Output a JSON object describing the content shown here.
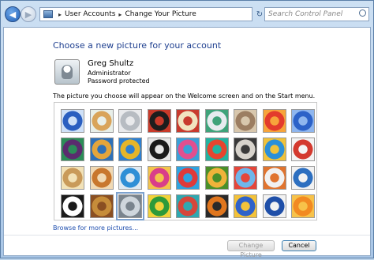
{
  "nav": {
    "breadcrumb": [
      "User Accounts",
      "Change Your Picture"
    ],
    "search_placeholder": "Search Control Panel",
    "back_glyph": "◀",
    "forward_glyph": "▶",
    "refresh_glyph": "↻",
    "crumb_separator": "▸"
  },
  "main": {
    "heading": "Choose a new picture for your account",
    "user": {
      "name": "Greg Shultz",
      "role": "Administrator",
      "status": "Password protected"
    },
    "info": "The picture you choose will appear on the Welcome screen and on the Start menu.",
    "pictures": [
      {
        "icon": "blue-glass-tile",
        "colors": [
          "#2a5fc0",
          "#cfe1f7"
        ]
      },
      {
        "icon": "starfish",
        "colors": [
          "#d9a45a",
          "#e8efe9"
        ]
      },
      {
        "icon": "robot-figure",
        "colors": [
          "#b7bcc2",
          "#e9eaec"
        ]
      },
      {
        "icon": "vinyl-record",
        "colors": [
          "#1d1d1d",
          "#c93a2a"
        ]
      },
      {
        "icon": "lucky-cat",
        "colors": [
          "#f1e3c0",
          "#c83a2e"
        ]
      },
      {
        "icon": "satellite-dish",
        "colors": [
          "#e7ecef",
          "#3fa37a"
        ]
      },
      {
        "icon": "kitten",
        "colors": [
          "#9c7e62",
          "#d8c7ad"
        ]
      },
      {
        "icon": "red-flower",
        "colors": [
          "#e33b2c",
          "#f7a43b"
        ]
      },
      {
        "icon": "blue-abstract",
        "colors": [
          "#2c62c8",
          "#8fb6ee"
        ]
      },
      {
        "icon": "purple-ball",
        "colors": [
          "#5b2b6e",
          "#2c8d58"
        ]
      },
      {
        "icon": "color-blocks",
        "colors": [
          "#e3a53b",
          "#2d70b8"
        ]
      },
      {
        "icon": "leaf",
        "colors": [
          "#e6b52a",
          "#2e7fd0"
        ]
      },
      {
        "icon": "puppy",
        "colors": [
          "#1a1a1a",
          "#e6e6e6"
        ]
      },
      {
        "icon": "crayons",
        "colors": [
          "#e24f8f",
          "#3aa0d8"
        ]
      },
      {
        "icon": "butterfly-pattern",
        "colors": [
          "#e6452f",
          "#23b3a0"
        ]
      },
      {
        "icon": "geometric-hearts",
        "colors": [
          "#d7d3cc",
          "#3a3a3a"
        ]
      },
      {
        "icon": "pool-stripes",
        "colors": [
          "#2a8fd8",
          "#f0c23a"
        ]
      },
      {
        "icon": "paper-crane",
        "colors": [
          "#d43a2f",
          "#f4f4f4"
        ]
      },
      {
        "icon": "guitar",
        "colors": [
          "#c99a5a",
          "#f2e2b8"
        ]
      },
      {
        "icon": "fox-cub",
        "colors": [
          "#c8772e",
          "#f0d9b4"
        ]
      },
      {
        "icon": "toy-robot",
        "colors": [
          "#2f8fd6",
          "#dfe9f1"
        ]
      },
      {
        "icon": "sari-fabric",
        "colors": [
          "#d93e8a",
          "#f3c34c"
        ]
      },
      {
        "icon": "rainbow-ribbons",
        "colors": [
          "#e03a3a",
          "#2fa3df"
        ]
      },
      {
        "icon": "sunset-field",
        "colors": [
          "#f0b33a",
          "#4a8f2a"
        ]
      },
      {
        "icon": "hot-air-balloons",
        "colors": [
          "#6fb6ea",
          "#e5463a"
        ]
      },
      {
        "icon": "clay-doll",
        "colors": [
          "#f1f1f1",
          "#e0742f"
        ]
      },
      {
        "icon": "sailboats",
        "colors": [
          "#2d6fc0",
          "#f2f2f2"
        ]
      },
      {
        "icon": "soccer-ball",
        "colors": [
          "#ffffff",
          "#1a1a1a"
        ]
      },
      {
        "icon": "wood-carving",
        "colors": [
          "#c68d3a",
          "#8a4f22"
        ]
      },
      {
        "icon": "robot-toy-selected",
        "colors": [
          "#cfd6dc",
          "#7a848d"
        ]
      },
      {
        "icon": "window-frame",
        "colors": [
          "#2d9a3a",
          "#f2d23a"
        ]
      },
      {
        "icon": "woven-fabric",
        "colors": [
          "#d6463a",
          "#2fa8b0"
        ]
      },
      {
        "icon": "monarch-butterfly",
        "colors": [
          "#e0761e",
          "#2a2a2a"
        ]
      },
      {
        "icon": "stained-glass",
        "colors": [
          "#2f62c9",
          "#f3c23a"
        ]
      },
      {
        "icon": "lighthouse",
        "colors": [
          "#1f4fa8",
          "#f2f2f2"
        ]
      },
      {
        "icon": "orange-flower",
        "colors": [
          "#f28a22",
          "#f7c24a"
        ]
      }
    ],
    "browse_link": "Browse for more pictures..."
  },
  "footer": {
    "change_picture": "Change Picture",
    "cancel": "Cancel"
  },
  "colors": {
    "heading": "#1e3f8f",
    "link": "#1f4faf",
    "selection": "#7da2ce"
  }
}
